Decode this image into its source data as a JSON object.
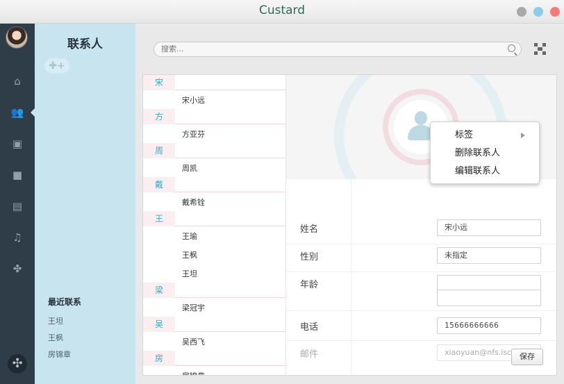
{
  "window": {
    "title": "Custard"
  },
  "sidebar": {
    "heading": "联系人",
    "add_button": "✚+",
    "recent_title": "最近联系",
    "recent": [
      "王坦",
      "王枫",
      "房锦章"
    ]
  },
  "search": {
    "placeholder": "搜索..."
  },
  "contacts": [
    {
      "type": "letter",
      "label": "宋"
    },
    {
      "type": "name",
      "label": "宋小远"
    },
    {
      "type": "letter",
      "label": "方"
    },
    {
      "type": "name",
      "label": "方亚芬"
    },
    {
      "type": "letter",
      "label": "周"
    },
    {
      "type": "name",
      "label": "周凯"
    },
    {
      "type": "letter",
      "label": "戴"
    },
    {
      "type": "name",
      "label": "戴希铨"
    },
    {
      "type": "letter",
      "label": "王"
    },
    {
      "type": "name",
      "label": "王瑜"
    },
    {
      "type": "name",
      "label": "王枫"
    },
    {
      "type": "name",
      "label": "王坦"
    },
    {
      "type": "letter",
      "label": "梁"
    },
    {
      "type": "name",
      "label": "梁冠宇"
    },
    {
      "type": "letter",
      "label": "吴"
    },
    {
      "type": "name",
      "label": "吴西飞"
    },
    {
      "type": "letter",
      "label": "房"
    },
    {
      "type": "name",
      "label": "房锦章"
    }
  ],
  "detail": {
    "name_label": "姓名",
    "name_value": "宋小远",
    "gender_label": "性别",
    "gender_value": "未指定",
    "age_label": "年龄",
    "age_value": "",
    "extra_value": "",
    "phone_label": "电话",
    "phone_value": "15666666666",
    "email_label": "邮件",
    "email_value": "xiaoyuan@nfs.iscas.",
    "save_label": "保存"
  },
  "context_menu": {
    "items": [
      "标签",
      "删除联系人",
      "编辑联系人"
    ]
  },
  "colors": {
    "rail": "#2f3d48",
    "sidebar": "#c7e4ef",
    "accent": "#3aa7c9",
    "title": "#2f6b52"
  },
  "icons": [
    "home-icon",
    "contacts-icon",
    "image-icon",
    "video-icon",
    "document-icon",
    "music-icon",
    "apps-icon",
    "fan-icon",
    "qr-code-icon",
    "search-icon"
  ]
}
